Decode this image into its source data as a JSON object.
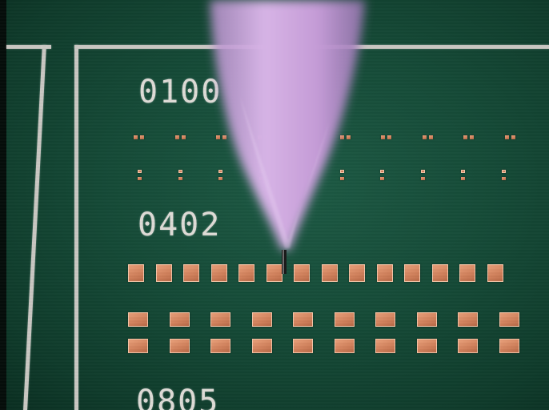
{
  "labels": {
    "size_0100": "0100",
    "size_0402": "0402",
    "size_0805": "0805"
  },
  "colors": {
    "board": "#154a37",
    "copper_pad": "#d9896a",
    "silkscreen": "#dedbd6",
    "probe": "#c6a0d8"
  },
  "pad_counts": {
    "row_0100_a": 10,
    "row_0100_b": 10,
    "row_0402": 14,
    "row_0805_a": 10,
    "row_0805_b": 10
  }
}
